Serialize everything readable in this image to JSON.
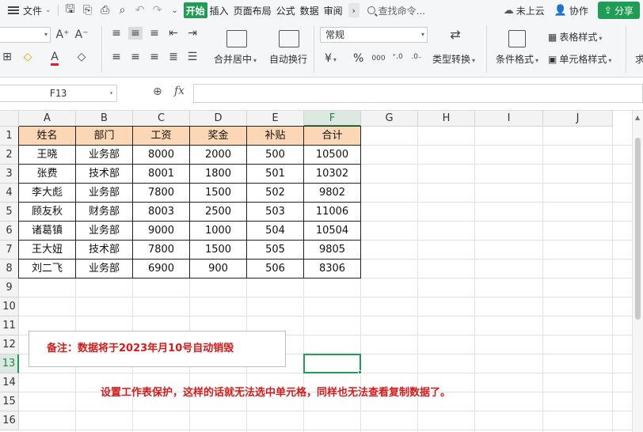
{
  "menubar": {
    "file_label": "文件",
    "tabs": [
      {
        "label": "开始",
        "active": true
      },
      {
        "label": "插入",
        "active": false
      },
      {
        "label": "页面布局",
        "active": false
      },
      {
        "label": "公式",
        "active": false
      },
      {
        "label": "数据",
        "active": false
      },
      {
        "label": "审阅",
        "active": false
      }
    ],
    "search_placeholder": "查找命令...",
    "cloud_label": "未上云",
    "collab_label": "协作",
    "share_label": "分享"
  },
  "ribbon": {
    "merge_center_label": "合并居中",
    "wrap_text_label": "自动换行",
    "number_format_value": "常规",
    "currency_symbol": "¥",
    "percent_symbol": "%",
    "type_convert_label": "类型转换",
    "cond_format_label": "条件格式",
    "table_style_label": "表格样式",
    "cell_style_label": "单元格样式",
    "partial_label": "求"
  },
  "formula_bar": {
    "name_box": "F13",
    "fx_label": "fx",
    "formula": ""
  },
  "grid": {
    "columns": [
      "A",
      "B",
      "C",
      "D",
      "E",
      "F",
      "G",
      "H",
      "I",
      "J"
    ],
    "rows": [
      "1",
      "2",
      "3",
      "4",
      "5",
      "6",
      "7",
      "8",
      "9",
      "10",
      "11",
      "12",
      "13",
      "14",
      "15",
      "16"
    ],
    "selected_column": "F",
    "selected_row": "13",
    "active_cell": "F13"
  },
  "table": {
    "headers": [
      "姓名",
      "部门",
      "工资",
      "奖金",
      "补贴",
      "合计"
    ],
    "rows": [
      [
        "王晓",
        "业务部",
        "8000",
        "2000",
        "500",
        "10500"
      ],
      [
        "张费",
        "技术部",
        "8001",
        "1800",
        "501",
        "10302"
      ],
      [
        "李大彪",
        "业务部",
        "7800",
        "1500",
        "502",
        "9802"
      ],
      [
        "顾友秋",
        "财务部",
        "8003",
        "2500",
        "503",
        "11006"
      ],
      [
        "诸葛镇",
        "业务部",
        "9000",
        "1000",
        "504",
        "10504"
      ],
      [
        "王大妞",
        "技术部",
        "7800",
        "1500",
        "505",
        "9805"
      ],
      [
        "刘二飞",
        "业务部",
        "6900",
        "900",
        "506",
        "8306"
      ]
    ],
    "header_fill": "#fcd7b5"
  },
  "notes": {
    "box_text": "备注：数据将于2023年月10号自动销毁",
    "message": "设置工作表保护，这样的话就无法选中单元格，同样也无法查看复制数据了。",
    "color": "#d91a1a"
  },
  "colors": {
    "accent": "#1f9d55"
  }
}
